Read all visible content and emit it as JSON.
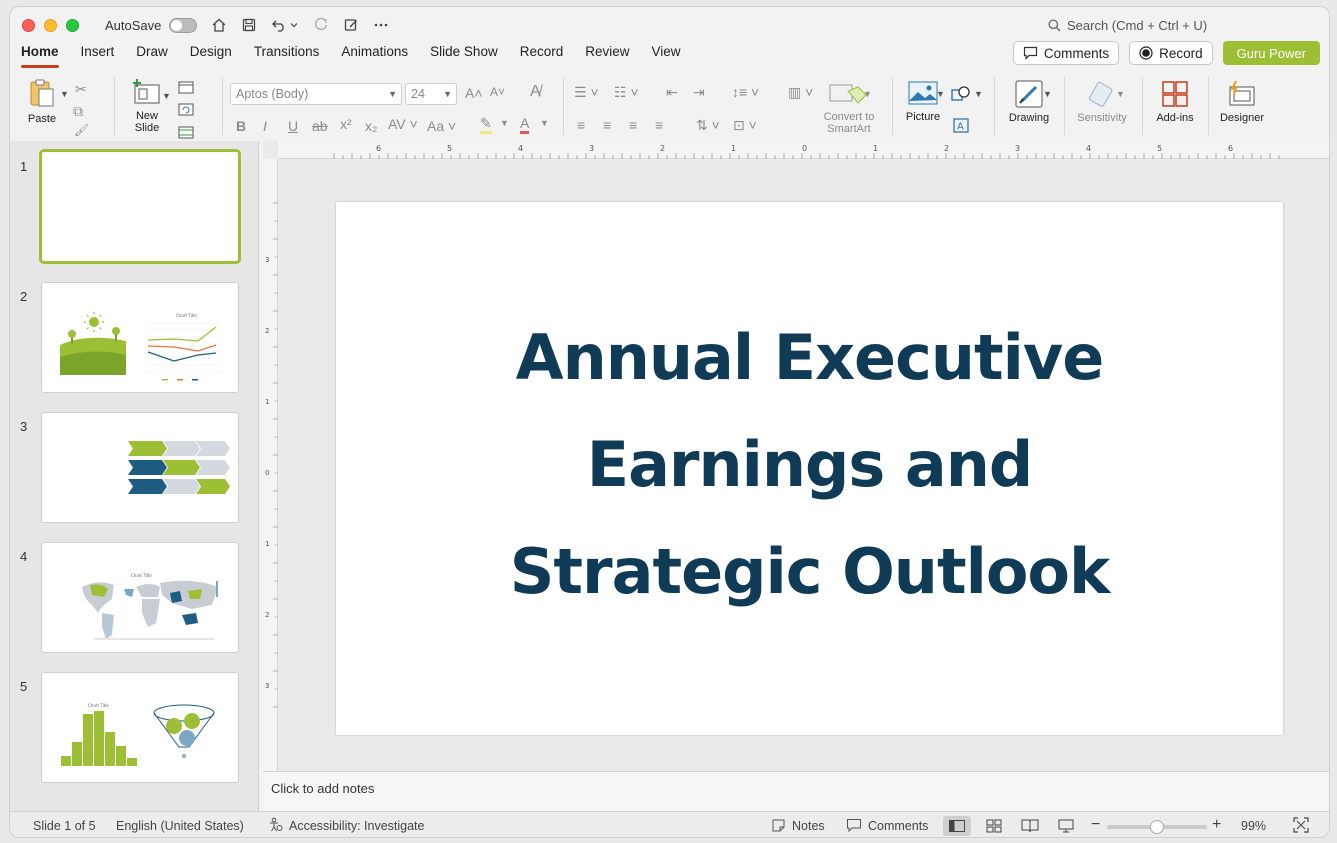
{
  "titlebar": {
    "autosave_label": "AutoSave",
    "search_placeholder": "Search (Cmd + Ctrl + U)"
  },
  "tabs": [
    "Home",
    "Insert",
    "Draw",
    "Design",
    "Transitions",
    "Animations",
    "Slide Show",
    "Record",
    "Review",
    "View"
  ],
  "active_tab": "Home",
  "top_right": {
    "comments_label": "Comments",
    "record_label": "Record",
    "guru_label": "Guru Power"
  },
  "ribbon": {
    "paste": "Paste",
    "new_slide_line1": "New",
    "new_slide_line2": "Slide",
    "font_name": "Aptos (Body)",
    "font_size": "24",
    "convert_line1": "Convert to",
    "convert_line2": "SmartArt",
    "picture": "Picture",
    "drawing": "Drawing",
    "sensitivity": "Sensitivity",
    "addins": "Add-ins",
    "designer": "Designer"
  },
  "slides": {
    "numbers": [
      "1",
      "2",
      "3",
      "4",
      "5"
    ],
    "thumb_chart_title": "Chart Title"
  },
  "main_slide": {
    "title_line1": "Annual Executive",
    "title_line2": "Earnings and",
    "title_line3": "Strategic Outlook"
  },
  "notes_placeholder": "Click to add notes",
  "status": {
    "slide_info": "Slide 1 of 5",
    "language": "English (United States)",
    "accessibility": "Accessibility: Investigate",
    "notes": "Notes",
    "comments": "Comments",
    "zoom": "99%",
    "zoom_value": 0.5
  },
  "colors": {
    "accent_green": "#9dbf36",
    "title_navy": "#0f3b56",
    "tab_underline": "#c43e1c"
  }
}
